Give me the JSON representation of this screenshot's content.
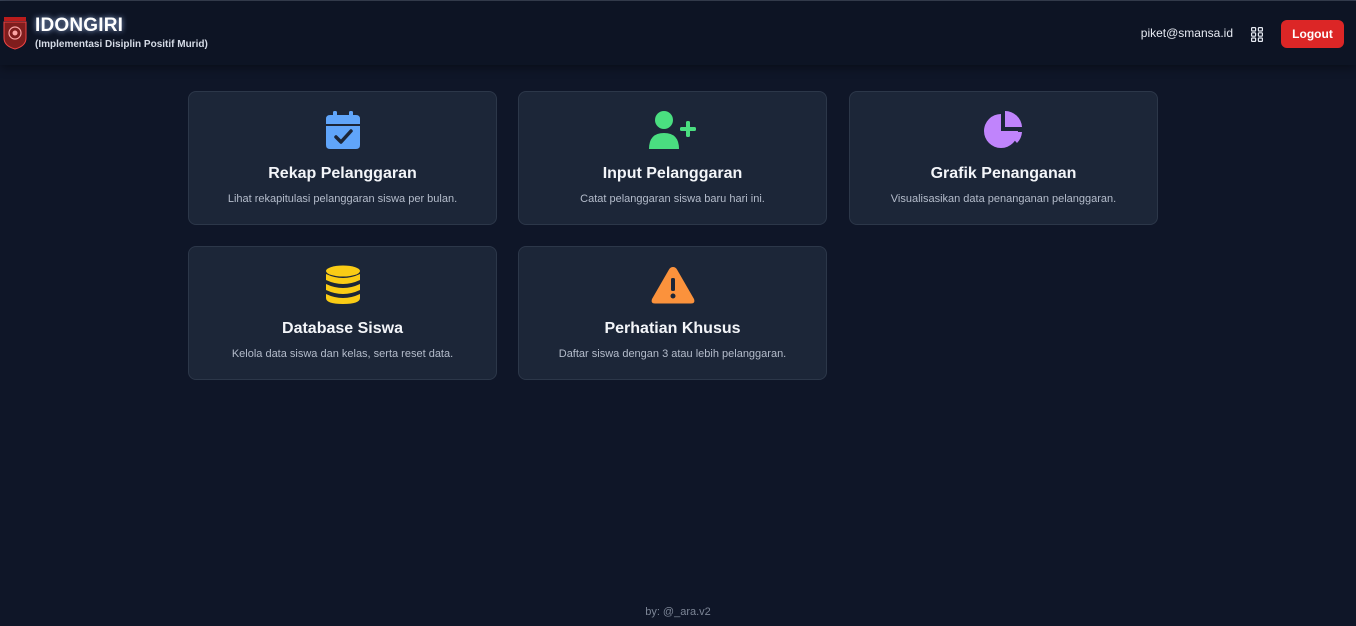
{
  "header": {
    "title": "IDONGIRI",
    "subtitle": "(Implementasi Disiplin Positif Murid)",
    "user_email": "piket@smansa.id",
    "logout_label": "Logout"
  },
  "cards": [
    {
      "title": "Rekap Pelanggaran",
      "description": "Lihat rekapitulasi pelanggaran siswa per bulan.",
      "icon": "calendar-check-icon",
      "icon_color": "#60a5fa"
    },
    {
      "title": "Input Pelanggaran",
      "description": "Catat pelanggaran siswa baru hari ini.",
      "icon": "user-plus-icon",
      "icon_color": "#4ade80"
    },
    {
      "title": "Grafik Penanganan",
      "description": "Visualisasikan data penanganan pelanggaran.",
      "icon": "chart-pie-icon",
      "icon_color": "#c084fc"
    },
    {
      "title": "Database Siswa",
      "description": "Kelola data siswa dan kelas, serta reset data.",
      "icon": "database-icon",
      "icon_color": "#facc15"
    },
    {
      "title": "Perhatian Khusus",
      "description": "Daftar siswa dengan 3 atau lebih pelanggaran.",
      "icon": "warning-icon",
      "icon_color": "#fb923c"
    }
  ],
  "footer": {
    "credit": "by: @_ara.v2"
  },
  "colors": {
    "background": "#0f1628",
    "card": "#1c2638",
    "logout": "#dc2626"
  }
}
